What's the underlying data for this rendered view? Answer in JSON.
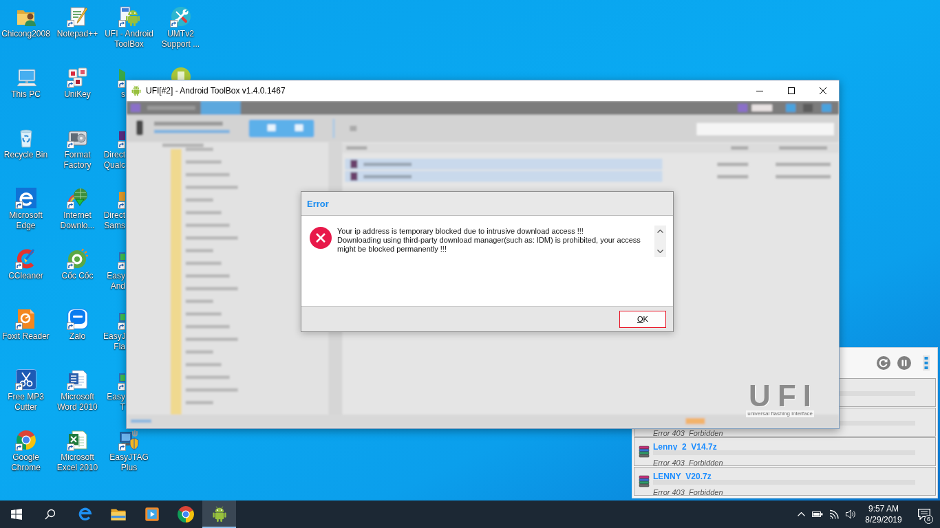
{
  "desktop": {
    "columns": [
      [
        {
          "label": "Chicong2008",
          "shortcut": false
        },
        {
          "label": "This PC",
          "shortcut": false
        },
        {
          "label": "Recycle Bin",
          "shortcut": false
        },
        {
          "label": "Microsoft Edge",
          "shortcut": true
        },
        {
          "label": "CCleaner",
          "shortcut": true
        },
        {
          "label": "Foxit Reader",
          "shortcut": true
        },
        {
          "label": "Free MP3 Cutter",
          "shortcut": true
        },
        {
          "label": "Google Chrome",
          "shortcut": true
        }
      ],
      [
        {
          "label": "Notepad++",
          "shortcut": true
        },
        {
          "label": "UniKey",
          "shortcut": true
        },
        {
          "label": "Format Factory",
          "shortcut": true
        },
        {
          "label": "Internet Downlo...",
          "shortcut": true
        },
        {
          "label": "Cốc Cốc",
          "shortcut": true
        },
        {
          "label": "Zalo",
          "shortcut": true
        },
        {
          "label": "Microsoft Word 2010",
          "shortcut": true
        },
        {
          "label": "Microsoft Excel 2010",
          "shortcut": true
        }
      ],
      [
        {
          "label": "UFI - Android ToolBox",
          "shortcut": true
        },
        {
          "label": "s",
          "shortcut": true
        },
        {
          "label": "Direct Qualc",
          "shortcut": true
        },
        {
          "label": "Direct Sams",
          "shortcut": true
        },
        {
          "label": "Easy And",
          "shortcut": true
        },
        {
          "label": "EasyJ Fla",
          "shortcut": true
        },
        {
          "label": "Easy T",
          "shortcut": true
        },
        {
          "label": "EasyJTAG Plus",
          "shortcut": true
        }
      ],
      [
        {
          "label": "UMTv2 Support ...",
          "shortcut": true
        },
        {}
      ]
    ]
  },
  "window": {
    "title": "UFI[#2] - Android ToolBox v1.4.0.1467",
    "logo": {
      "name": "UFI",
      "tagline": "universal flashing interface"
    }
  },
  "dialog": {
    "title": "Error",
    "message": [
      "Your ip address is temporary blocked due to intrusive download access !!!",
      "Downloading using third-party download manager(such as: IDM) is prohibited, your access might be blocked permanently !!!"
    ],
    "buttons": [
      {
        "label": "OK",
        "focused": true
      }
    ]
  },
  "downloads": {
    "items": [
      {
        "kind": "covered"
      },
      {
        "kind": "covered",
        "status": "Error 403  Forbidden"
      },
      {
        "kind": "file",
        "name": "Lenny_2_V14.7z",
        "status": "Error 403  Forbidden"
      },
      {
        "kind": "file",
        "name": "LENNY_V20.7z",
        "status": "Error 403  Forbidden"
      }
    ]
  },
  "taskbar": {
    "apps": [
      {
        "selected": false
      },
      {
        "selected": false
      },
      {
        "selected": false
      },
      {
        "selected": false
      },
      {
        "selected": true
      }
    ],
    "clock": {
      "time": "9:57 AM",
      "date": "8/29/2019"
    },
    "notifications": "6"
  }
}
